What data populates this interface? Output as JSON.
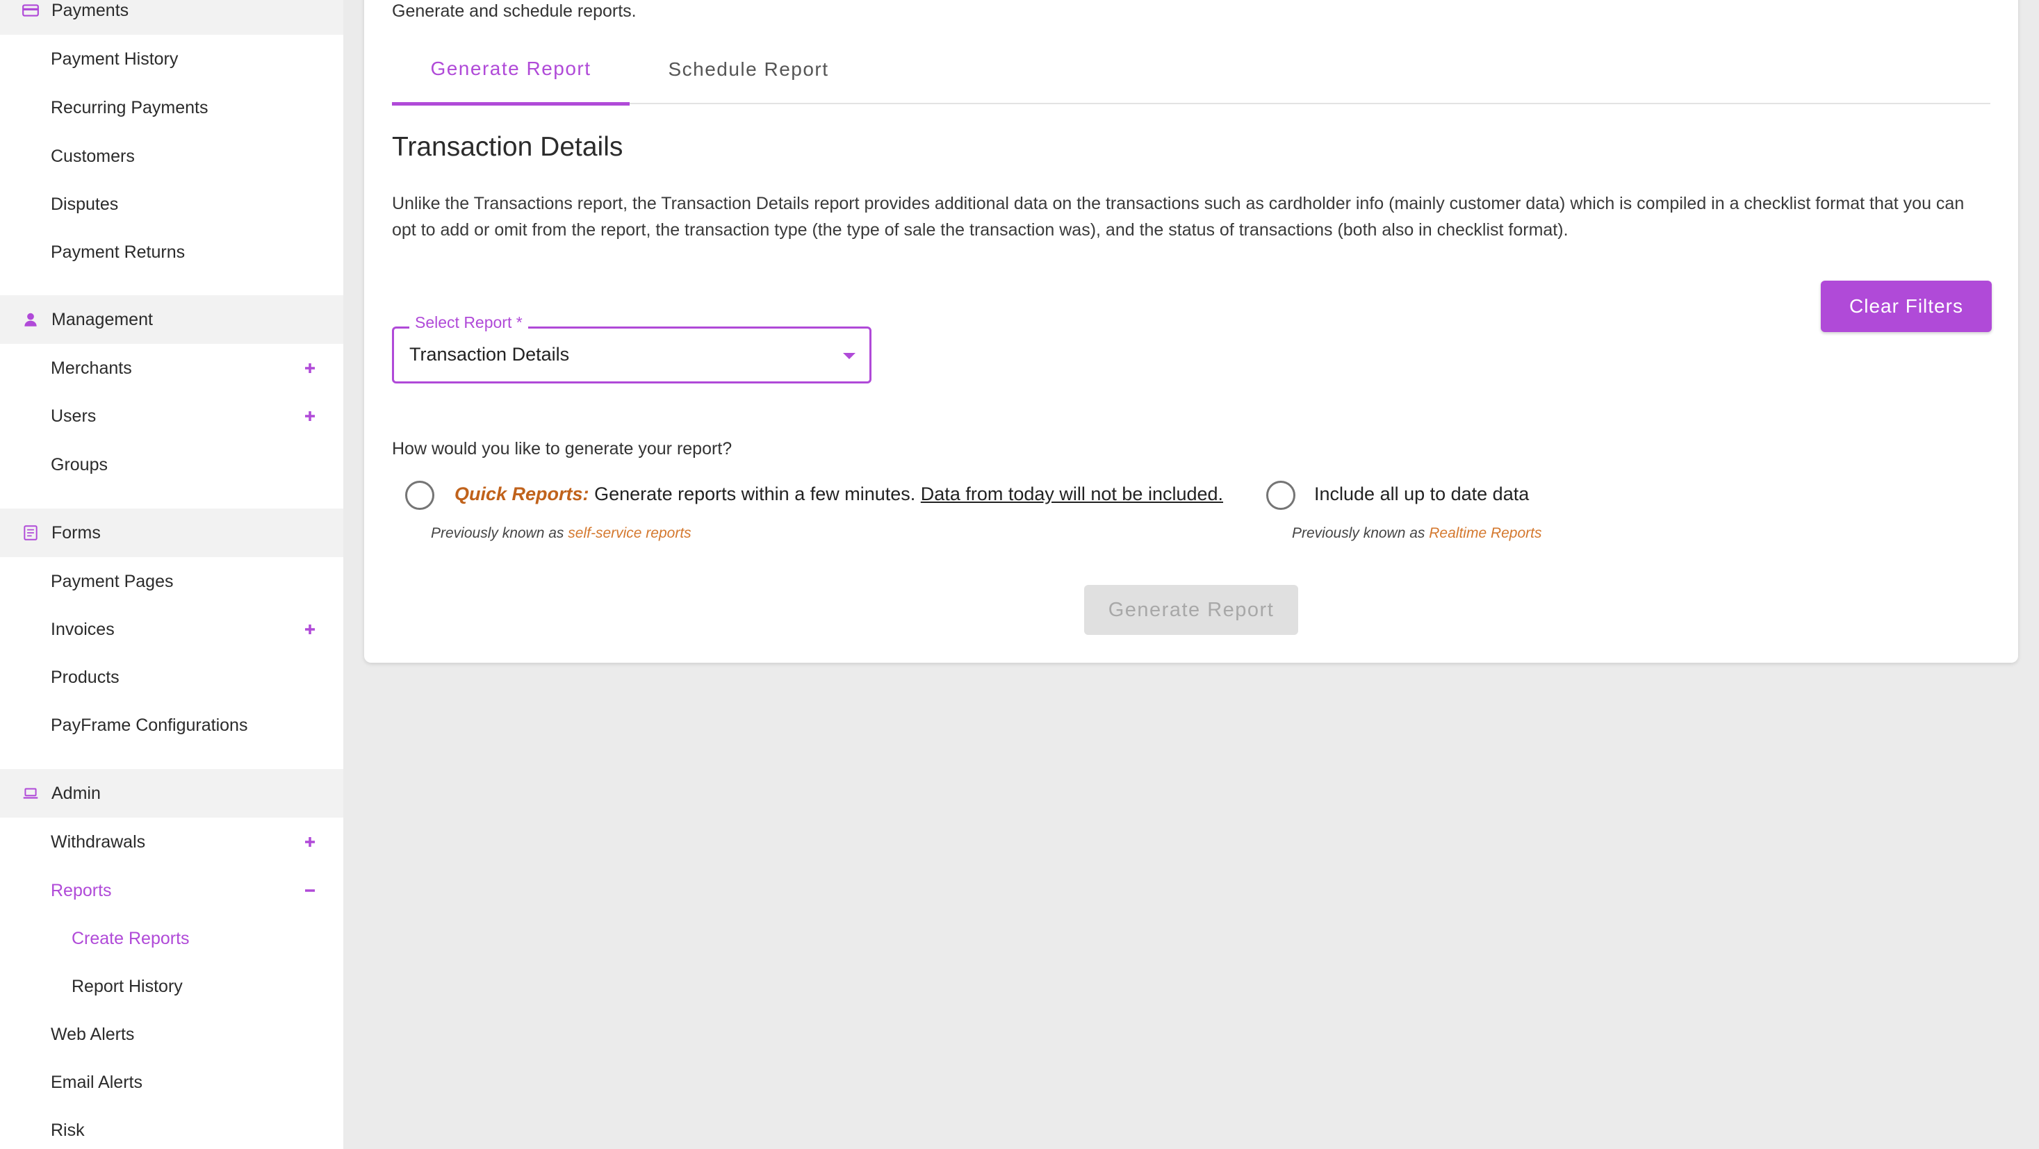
{
  "colors": {
    "accent": "#b04ad8",
    "orange": "#c0621b",
    "orange_light": "#d4782e",
    "section_bg": "#f2f2f2",
    "page_bg": "#ebebeb"
  },
  "sidebar": {
    "sections": [
      {
        "title": "Payments",
        "icon": "credit-card-icon",
        "items": [
          {
            "label": "Payment History"
          },
          {
            "label": "Recurring Payments"
          },
          {
            "label": "Customers"
          },
          {
            "label": "Disputes"
          },
          {
            "label": "Payment Returns"
          }
        ]
      },
      {
        "title": "Management",
        "icon": "person-icon",
        "items": [
          {
            "label": "Merchants",
            "control": "plus-icon"
          },
          {
            "label": "Users",
            "control": "plus-icon"
          },
          {
            "label": "Groups"
          }
        ]
      },
      {
        "title": "Forms",
        "icon": "form-icon",
        "items": [
          {
            "label": "Payment Pages"
          },
          {
            "label": "Invoices",
            "control": "plus-icon"
          },
          {
            "label": "Products"
          },
          {
            "label": "PayFrame Configurations"
          }
        ]
      },
      {
        "title": "Admin",
        "icon": "laptop-icon",
        "items": [
          {
            "label": "Withdrawals",
            "control": "plus-icon"
          },
          {
            "label": "Reports",
            "control": "minus-icon",
            "active": true
          },
          {
            "label": "Create Reports",
            "sub": true,
            "active": true
          },
          {
            "label": "Report History",
            "sub": true
          },
          {
            "label": "Web Alerts"
          },
          {
            "label": "Email Alerts"
          },
          {
            "label": "Risk"
          }
        ]
      }
    ]
  },
  "main": {
    "intro": "Generate and schedule reports.",
    "tabs": [
      {
        "label": "Generate Report",
        "active": true
      },
      {
        "label": "Schedule Report",
        "active": false
      }
    ],
    "heading": "Transaction Details",
    "description": "Unlike the Transactions report, the Transaction Details report provides additional data on the transactions such as cardholder info (mainly customer data) which is compiled in a checklist format that you can opt to add or omit from the report, the transaction type (the type of sale the transaction was), and the status of transactions (both also in checklist format).",
    "clear_filters_label": "Clear Filters",
    "select": {
      "label": "Select Report *",
      "value": "Transaction Details"
    },
    "question": "How would you like to generate your report?",
    "options": {
      "quick": {
        "prefix": "Quick Reports:",
        "text": "Generate reports within a few minutes.",
        "underlined": "Data from today will not be included.",
        "note_prefix": "Previously known as",
        "note_highlight": "self-service reports",
        "selected": false
      },
      "realtime": {
        "text": "Include all up to date data",
        "note_prefix": "Previously known as",
        "note_highlight": "Realtime Reports",
        "selected": false
      }
    },
    "generate_label": "Generate Report"
  }
}
